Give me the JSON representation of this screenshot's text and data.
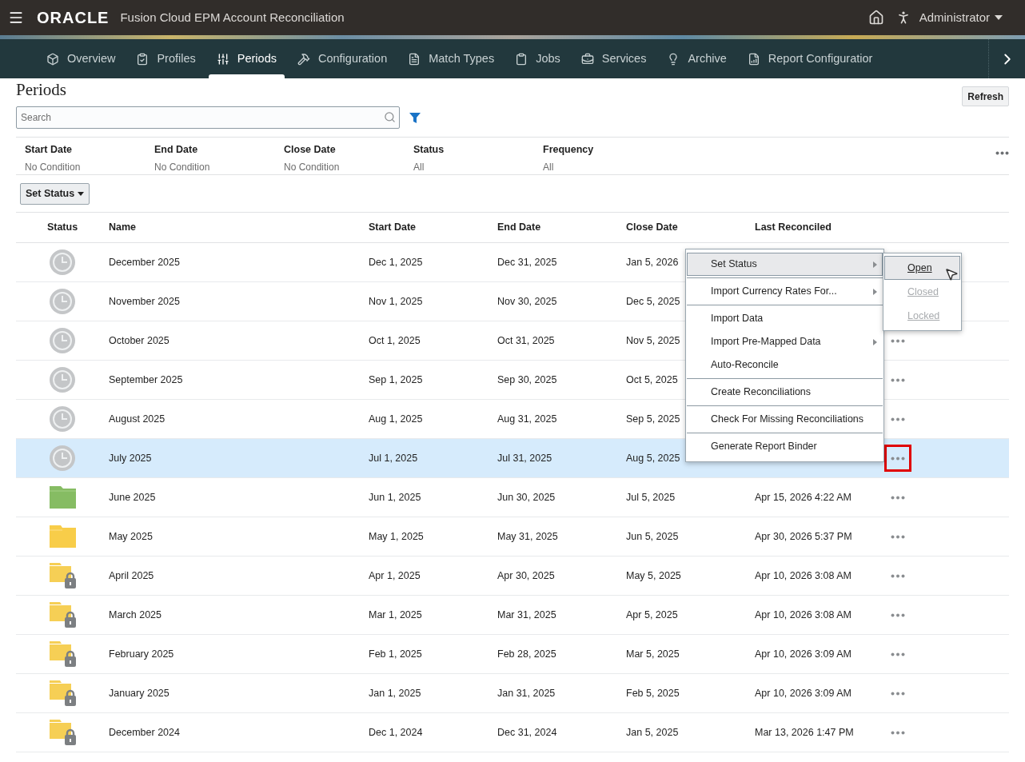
{
  "header": {
    "brand": "ORACLE",
    "app_title": "Fusion Cloud EPM Account Reconciliation",
    "user": "Administrator"
  },
  "nav": [
    {
      "label": "Overview",
      "selected": false
    },
    {
      "label": "Profiles",
      "selected": false
    },
    {
      "label": "Periods",
      "selected": true
    },
    {
      "label": "Configuration",
      "selected": false
    },
    {
      "label": "Match Types",
      "selected": false
    },
    {
      "label": "Jobs",
      "selected": false
    },
    {
      "label": "Services",
      "selected": false
    },
    {
      "label": "Archive",
      "selected": false
    },
    {
      "label": "Report Configuratior",
      "selected": false
    }
  ],
  "page": {
    "title": "Periods",
    "refresh": "Refresh",
    "search_placeholder": "Search",
    "set_status": "Set Status"
  },
  "filters": [
    {
      "label": "Start Date",
      "value": "No Condition"
    },
    {
      "label": "End Date",
      "value": "No Condition"
    },
    {
      "label": "Close Date",
      "value": "No Condition"
    },
    {
      "label": "Status",
      "value": "All"
    },
    {
      "label": "Frequency",
      "value": "All"
    }
  ],
  "table": {
    "columns": [
      "Status",
      "Name",
      "Start Date",
      "End Date",
      "Close Date",
      "Last Reconciled"
    ],
    "rows": [
      {
        "kind": "pending",
        "name": "December 2025",
        "start": "Dec 1, 2025",
        "end": "Dec 31, 2025",
        "close": "Jan 5, 2026",
        "actions": false,
        "selected": false
      },
      {
        "kind": "pending",
        "name": "November 2025",
        "start": "Nov 1, 2025",
        "end": "Nov 30, 2025",
        "close": "Dec 5, 2025",
        "actions": false,
        "selected": false
      },
      {
        "kind": "pending",
        "name": "October 2025",
        "start": "Oct 1, 2025",
        "end": "Oct 31, 2025",
        "close": "Nov 5, 2025",
        "actions": true,
        "selected": false
      },
      {
        "kind": "pending",
        "name": "September 2025",
        "start": "Sep 1, 2025",
        "end": "Sep 30, 2025",
        "close": "Oct 5, 2025",
        "actions": true,
        "selected": false
      },
      {
        "kind": "pending",
        "name": "August 2025",
        "start": "Aug 1, 2025",
        "end": "Aug 31, 2025",
        "close": "Sep 5, 2025",
        "actions": true,
        "selected": false
      },
      {
        "kind": "pending",
        "name": "July 2025",
        "start": "Jul 1, 2025",
        "end": "Jul 31, 2025",
        "close": "Aug 5, 2025",
        "actions": true,
        "selected": true
      },
      {
        "kind": "open",
        "name": "June 2025",
        "start": "Jun 1, 2025",
        "end": "Jun 30, 2025",
        "close": "Jul 5, 2025",
        "last": "Apr 15, 2026 4:22 AM",
        "actions": true,
        "selected": false
      },
      {
        "kind": "closed",
        "name": "May 2025",
        "start": "May 1, 2025",
        "end": "May 31, 2025",
        "close": "Jun 5, 2025",
        "last": "Apr 30, 2026 5:37 PM",
        "actions": true,
        "selected": false
      },
      {
        "kind": "locked",
        "name": "April 2025",
        "start": "Apr 1, 2025",
        "end": "Apr 30, 2025",
        "close": "May 5, 2025",
        "last": "Apr 10, 2026 3:08 AM",
        "actions": true,
        "selected": false
      },
      {
        "kind": "locked",
        "name": "March 2025",
        "start": "Mar 1, 2025",
        "end": "Mar 31, 2025",
        "close": "Apr 5, 2025",
        "last": "Apr 10, 2026 3:08 AM",
        "actions": true,
        "selected": false
      },
      {
        "kind": "locked",
        "name": "February 2025",
        "start": "Feb 1, 2025",
        "end": "Feb 28, 2025",
        "close": "Mar 5, 2025",
        "last": "Apr 10, 2026 3:09 AM",
        "actions": true,
        "selected": false
      },
      {
        "kind": "locked",
        "name": "January 2025",
        "start": "Jan 1, 2025",
        "end": "Jan 31, 2025",
        "close": "Feb 5, 2025",
        "last": "Apr 10, 2026 3:09 AM",
        "actions": true,
        "selected": false
      },
      {
        "kind": "locked",
        "name": "December 2024",
        "start": "Dec 1, 2024",
        "end": "Dec 31, 2024",
        "close": "Jan 5, 2025",
        "last": "Mar 13, 2026 1:47 PM",
        "actions": true,
        "selected": false
      }
    ]
  },
  "context_menu": [
    {
      "label": "Set Status",
      "submenu": true,
      "selected": true,
      "separator_after": true
    },
    {
      "label": "Import Currency Rates For...",
      "submenu": true,
      "selected": false,
      "separator_after": true
    },
    {
      "label": "Import Data",
      "submenu": false,
      "selected": false,
      "separator_after": false
    },
    {
      "label": "Import Pre-Mapped Data",
      "submenu": true,
      "selected": false,
      "separator_after": false
    },
    {
      "label": "Auto-Reconcile",
      "submenu": false,
      "selected": false,
      "separator_after": true
    },
    {
      "label": "Create Reconciliations",
      "submenu": false,
      "selected": false,
      "separator_after": true
    },
    {
      "label": "Check For Missing Reconciliations",
      "submenu": false,
      "selected": false,
      "separator_after": true
    },
    {
      "label": "Generate Report Binder",
      "submenu": false,
      "selected": false,
      "separator_after": false
    }
  ],
  "submenu": [
    {
      "label": "Open",
      "selected": true,
      "disabled": false
    },
    {
      "label": "Closed",
      "selected": false,
      "disabled": true
    },
    {
      "label": "Locked",
      "selected": false,
      "disabled": true
    }
  ]
}
